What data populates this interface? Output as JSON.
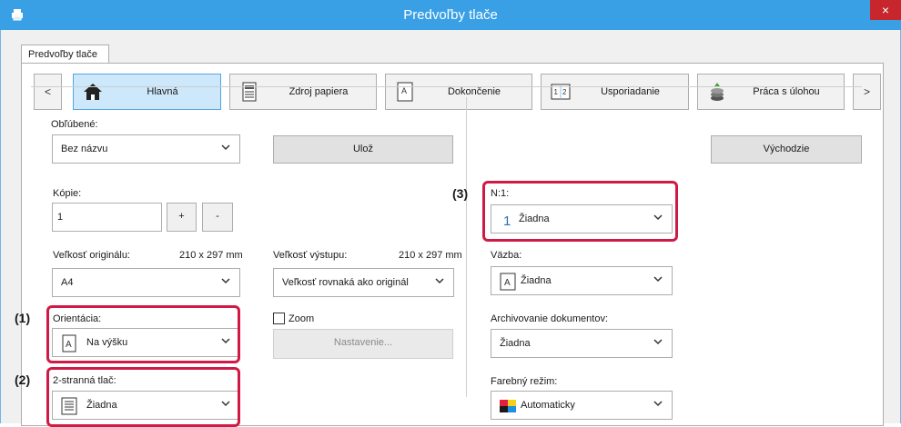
{
  "window": {
    "title": "Predvoľby tlače",
    "close_glyph": "×"
  },
  "tab": {
    "label": "Predvoľby tlače"
  },
  "nav": {
    "prev_glyph": "<",
    "next_glyph": ">",
    "items": [
      {
        "label": "Hlavná",
        "icon": "home-icon",
        "active": true
      },
      {
        "label": "Zdroj papiera",
        "icon": "paper-tray-icon"
      },
      {
        "label": "Dokončenie",
        "icon": "finishing-icon"
      },
      {
        "label": "Usporiadanie",
        "icon": "layout-icon",
        "icon_text": "1|2"
      },
      {
        "label": "Práca s úlohou",
        "icon": "job-handling-icon"
      }
    ]
  },
  "favorites": {
    "label": "Obľúbené:",
    "value": "Bez názvu",
    "save_label": "Ulož",
    "defaults_label": "Východzie"
  },
  "copies": {
    "label": "Kópie:",
    "value": "1",
    "plus": "+",
    "minus": "-"
  },
  "original_size": {
    "label": "Veľkosť originálu:",
    "dims": "210 x 297 mm",
    "value": "A4"
  },
  "output_size": {
    "label": "Veľkosť výstupu:",
    "dims": "210 x 297 mm",
    "value": "Veľkosť rovnaká ako originál"
  },
  "orientation": {
    "label": "Orientácia:",
    "value": "Na výšku",
    "icon_text": "A"
  },
  "zoom": {
    "label": "Zoom",
    "settings_label": "Nastavenie..."
  },
  "duplex": {
    "label": "2-stranná tlač:",
    "value": "Žiadna"
  },
  "nup": {
    "label": "N:1:",
    "value": "Žiadna",
    "icon_text": "1"
  },
  "binding": {
    "label": "Väzba:",
    "value": "Žiadna",
    "icon_text": "A"
  },
  "archiving": {
    "label": "Archivovanie dokumentov:",
    "value": "Žiadna"
  },
  "color_mode": {
    "label": "Farebný režim:",
    "value": "Automaticky"
  },
  "callouts": {
    "c1": "(1)",
    "c2": "(2)",
    "c3": "(3)"
  },
  "colors": {
    "titlebar": "#3aa0e6",
    "highlight": "#d01a46",
    "close": "#c7262d"
  }
}
